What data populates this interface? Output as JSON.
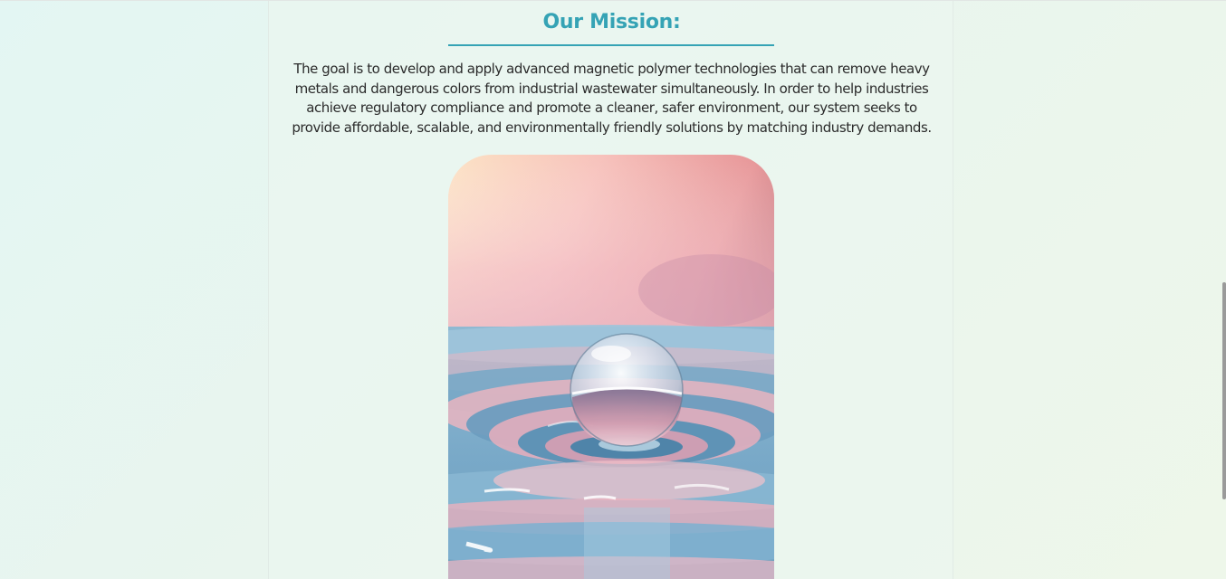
{
  "mission": {
    "title": "Our Mission:",
    "paragraph": "The goal is to develop and apply advanced magnetic polymer technologies that can remove heavy metals and dangerous colors from industrial wastewater simultaneously. In order to help industries achieve regulatory compliance and promote a cleaner, safer environment, our system seeks to provide affordable, scalable, and environmentally friendly solutions by matching industry demands.",
    "image_subject": "water-droplet-ripple"
  },
  "colors": {
    "accent": "#35a3b5",
    "text": "#2b2b2b"
  }
}
